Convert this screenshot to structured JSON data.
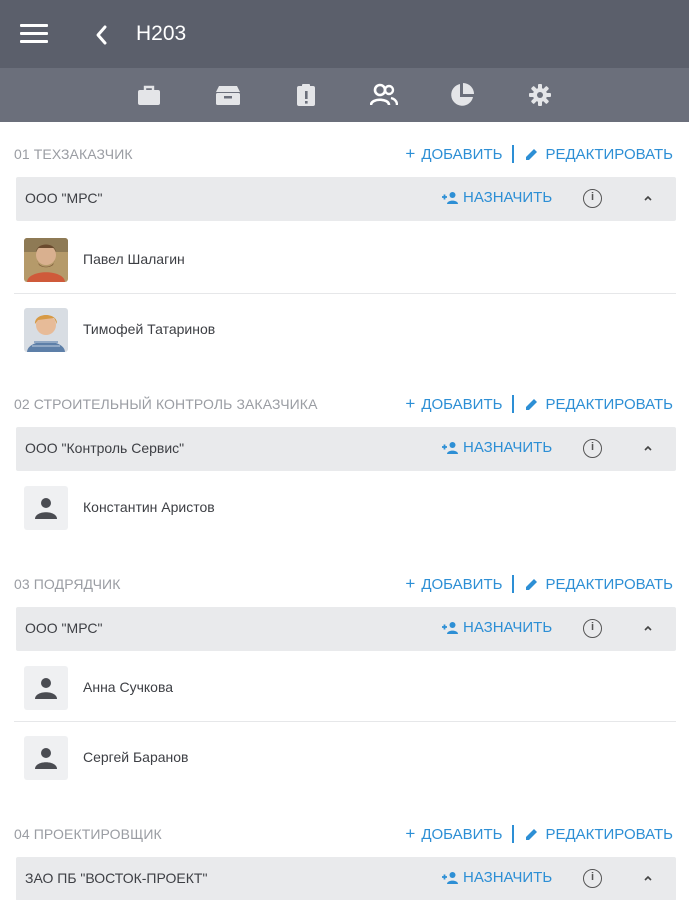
{
  "header": {
    "title": "H203"
  },
  "tabs": [
    {
      "icon": "briefcase-icon",
      "active": false
    },
    {
      "icon": "archive-icon",
      "active": false
    },
    {
      "icon": "clipboard-alert-icon",
      "active": false
    },
    {
      "icon": "people-icon",
      "active": true
    },
    {
      "icon": "pie-chart-icon",
      "active": false
    },
    {
      "icon": "gear-icon",
      "active": false
    }
  ],
  "labels": {
    "add": "ДОБАВИТЬ",
    "edit": "РЕДАКТИРОВАТЬ",
    "assign": "НАЗНАЧИТЬ",
    "info": "i"
  },
  "sections": [
    {
      "title": "01 ТЕХЗАКАЗЧИК",
      "org": "ООО \"МРС\"",
      "people": [
        {
          "name": "Павел Шалагин",
          "avatar": "photo"
        },
        {
          "name": "Тимофей Татаринов",
          "avatar": "photo"
        }
      ]
    },
    {
      "title": "02 СТРОИТЕЛЬНЫЙ КОНТРОЛЬ ЗАКАЗЧИКА",
      "org": "ООО \"Контроль Сервис\"",
      "people": [
        {
          "name": "Константин Аристов",
          "avatar": "placeholder"
        }
      ]
    },
    {
      "title": "03 ПОДРЯДЧИК",
      "org": "ООО \"МРС\"",
      "people": [
        {
          "name": "Анна Сучкова",
          "avatar": "placeholder"
        },
        {
          "name": "Сергей Баранов",
          "avatar": "placeholder"
        }
      ]
    },
    {
      "title": "04 ПРОЕКТИРОВЩИК",
      "org": "ЗАО ПБ \"ВОСТОК-ПРОЕКТ\"",
      "people": []
    }
  ],
  "colors": {
    "header": "#5b5f6b",
    "tabbar": "#6b6f7b",
    "accent": "#2d8fd5",
    "org_bg": "#e9eaec"
  }
}
